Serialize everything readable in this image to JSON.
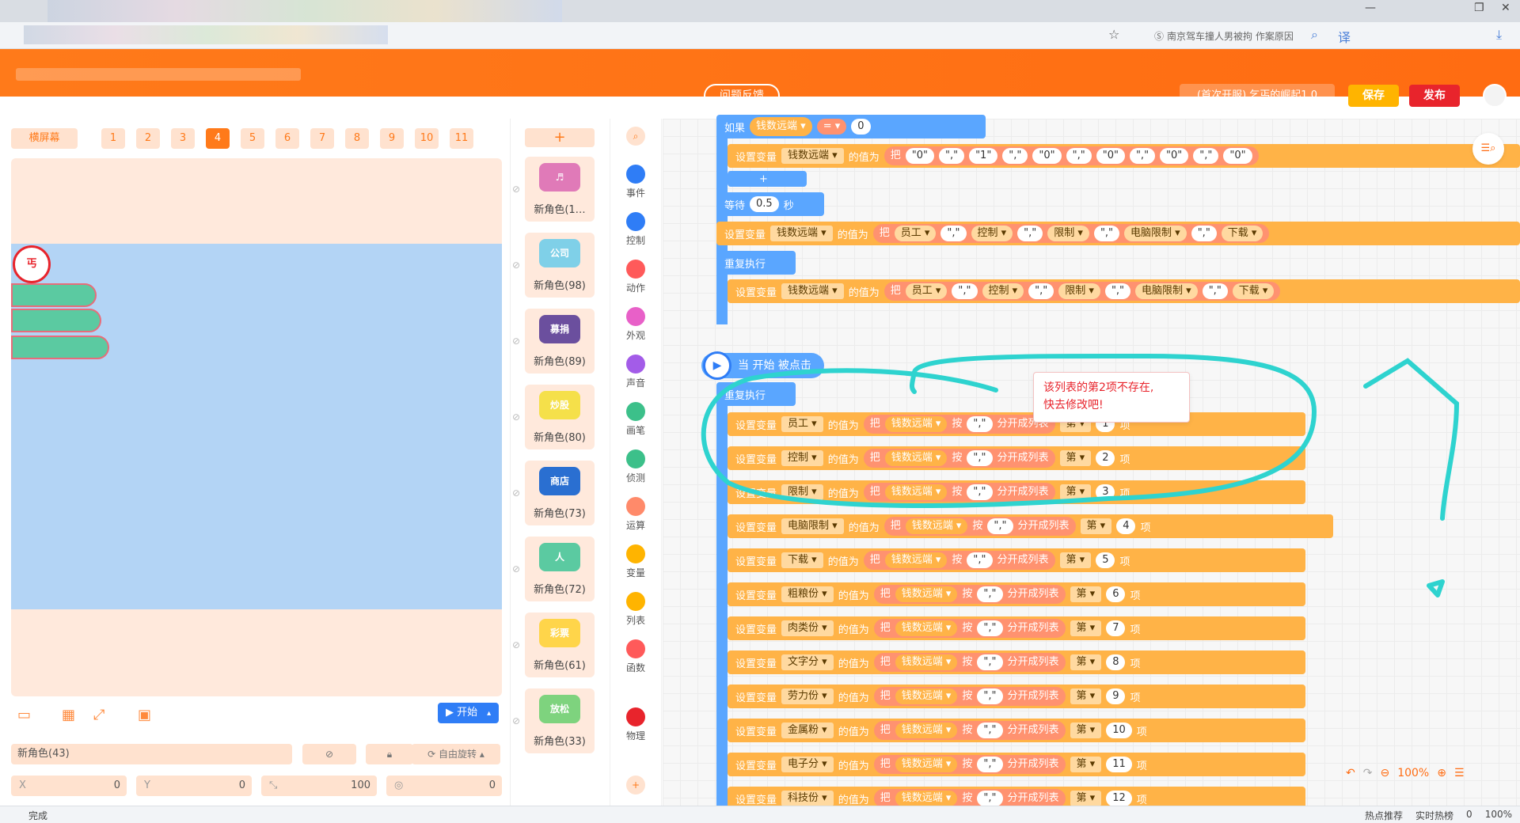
{
  "browser": {
    "search_text": "南京驾车撞人男被拘 作案原因",
    "zoom": "100%",
    "status_left": "完成",
    "status_hot": "热点推荐",
    "status_realtime": "实时热榜",
    "status_zero": "0"
  },
  "header": {
    "feedback": "问题反馈",
    "project": "(首次开服) 乞丐的崛起1.0",
    "save": "保存",
    "publish": "发布"
  },
  "stage": {
    "screen_label": "横屏幕",
    "tabs": [
      "1",
      "2",
      "3",
      "4",
      "5",
      "6",
      "7",
      "8",
      "9",
      "10",
      "11"
    ],
    "active_tab": "4",
    "start": "开始",
    "sprite_name": "新角色(43)",
    "rotation": "自由旋转",
    "x_label": "X",
    "x_val": "0",
    "y_label": "Y",
    "y_val": "0",
    "size_val": "100",
    "dir_val": "0",
    "logo_text": "丐"
  },
  "sprites": [
    {
      "label": "新角色(1…",
      "thumb": "♬",
      "color": "#e07ab8"
    },
    {
      "label": "新角色(98)",
      "thumb": "公司",
      "color": "#7fd0e8"
    },
    {
      "label": "新角色(89)",
      "thumb": "募捐",
      "color": "#6b4f9e"
    },
    {
      "label": "新角色(80)",
      "thumb": "炒股",
      "color": "#f5e04a"
    },
    {
      "label": "新角色(73)",
      "thumb": "商店",
      "color": "#2a6fd1"
    },
    {
      "label": "新角色(72)",
      "thumb": "人",
      "color": "#5bcaa1"
    },
    {
      "label": "新角色(61)",
      "thumb": "彩票",
      "color": "#ffd54a"
    },
    {
      "label": "新角色(33)",
      "thumb": "放松",
      "color": "#7ed37e"
    }
  ],
  "categories": [
    {
      "label": "事件",
      "color": "#2f7df6"
    },
    {
      "label": "控制",
      "color": "#2f7df6"
    },
    {
      "label": "动作",
      "color": "#ff5a5a"
    },
    {
      "label": "外观",
      "color": "#e860c8"
    },
    {
      "label": "声音",
      "color": "#a35ce8"
    },
    {
      "label": "画笔",
      "color": "#3cc08a"
    },
    {
      "label": "侦测",
      "color": "#3cc08a"
    },
    {
      "label": "运算",
      "color": "#ff8a6a"
    },
    {
      "label": "变量",
      "color": "#ffb400"
    },
    {
      "label": "列表",
      "color": "#ffb400"
    },
    {
      "label": "函数",
      "color": "#ff5a5a"
    },
    {
      "label": "物理",
      "color": "#e8242c"
    }
  ],
  "code": {
    "if_label": "如果",
    "var_remote": "钱数远端",
    "eq": "=",
    "zero": "0",
    "set_label": "设置变量",
    "value_label": "的值为",
    "ba": "把",
    "init_items": [
      "\"0\"",
      "\",\"",
      "\"1\"",
      "\",\"",
      "\"0\"",
      "\",\"",
      "\"0\"",
      "\",\"",
      "\"0\"",
      "\",\"",
      "\"0\""
    ],
    "wait": "等待",
    "wait_val": "0.5",
    "seconds": "秒",
    "repeat": "重复执行",
    "join_items": [
      "员工",
      "\",\"",
      "控制",
      "\",\"",
      "限制",
      "\",\"",
      "电脑限制",
      "\",\"",
      "下载"
    ],
    "hat": "当 开始 被点击",
    "split_by": "按",
    "comma": "\",\"",
    "split_into": "分开成列表",
    "nth": "第",
    "item": "项",
    "rows": [
      {
        "var": "员工",
        "idx": "1"
      },
      {
        "var": "控制",
        "idx": "2"
      },
      {
        "var": "限制",
        "idx": "3"
      },
      {
        "var": "电脑限制",
        "idx": "4"
      },
      {
        "var": "下载",
        "idx": "5"
      },
      {
        "var": "粗粮份",
        "idx": "6"
      },
      {
        "var": "肉类份",
        "idx": "7"
      },
      {
        "var": "文字分",
        "idx": "8"
      },
      {
        "var": "劳力份",
        "idx": "9"
      },
      {
        "var": "金属粉",
        "idx": "10"
      },
      {
        "var": "电子分",
        "idx": "11"
      },
      {
        "var": "科技份",
        "idx": "12"
      }
    ],
    "error_line1": "该列表的第2项不存在,",
    "error_line2": "快去修改吧!",
    "zoom": "100%"
  }
}
